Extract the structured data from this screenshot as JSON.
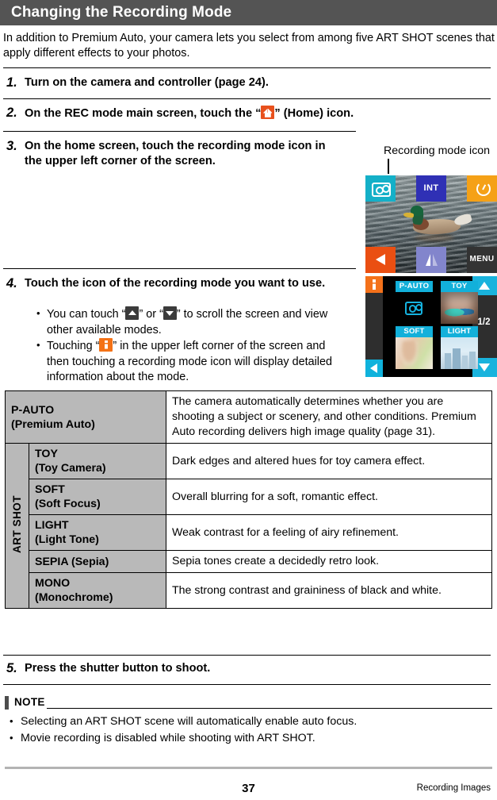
{
  "header": {
    "title": "Changing the Recording Mode"
  },
  "intro": "In addition to Premium Auto, your camera lets you select from among five ART SHOT scenes that apply different effects to your photos.",
  "steps": [
    {
      "num": "1.",
      "text_before": "Turn on the camera and controller (page 24).",
      "text_after": ""
    },
    {
      "num": "2.",
      "text_before": "On the REC mode main screen, touch the “",
      "text_after": "” (Home) icon."
    },
    {
      "num": "3.",
      "text_before": "On the home screen, touch the recording mode icon in the upper left corner of the screen.",
      "text_after": ""
    },
    {
      "num": "4.",
      "text_before": "Touch the icon of the recording mode you want to use.",
      "text_after": ""
    },
    {
      "num": "5.",
      "text_before": "Press the shutter button to shoot.",
      "text_after": ""
    }
  ],
  "step4_bullets": [
    {
      "part1": "You can touch “",
      "part2": "” or “",
      "part3": "” to scroll the screen and view other available modes."
    },
    {
      "part1": "Touching “",
      "part2": "” in the upper left corner of the screen and then touching a recording mode icon will display detailed information about the mode."
    }
  ],
  "callout": {
    "label": "Recording mode icon"
  },
  "screen_home": {
    "tiles": [
      {
        "name": "camera-mode",
        "label": "",
        "icon": "camera-icon",
        "color": "#14b0c8"
      },
      {
        "name": "interval",
        "label": "INT",
        "icon": "",
        "color": "#2f30b5"
      },
      {
        "name": "self-timer",
        "label": "",
        "icon": "timer-icon",
        "color": "#f5a117"
      },
      {
        "name": "back",
        "label": "",
        "icon": "triangle-left-icon",
        "color": "#ea4f12"
      },
      {
        "name": "flip",
        "label": "",
        "icon": "flip-icon",
        "color": "#8285cc"
      },
      {
        "name": "menu",
        "label": "MENU",
        "icon": "",
        "color": "#333333"
      }
    ]
  },
  "screen_modes": {
    "page_indicator": "1/2",
    "cells": [
      {
        "label": "P-AUTO",
        "thumb": "camera-icon"
      },
      {
        "label": "TOY",
        "thumb": "toy-photo"
      },
      {
        "label": "SOFT",
        "thumb": "soft-photo"
      },
      {
        "label": "LIGHT",
        "thumb": "light-photo"
      }
    ]
  },
  "table": {
    "group_label": "ART SHOT",
    "rows": [
      {
        "name": "P-AUTO\n(Premium Auto)",
        "name_l1": "P-AUTO",
        "name_l2": "(Premium Auto)",
        "desc": "The camera automatically determines whether you are shooting a subject or scenery, and other conditions. Premium Auto recording delivers high image quality (page 31)."
      },
      {
        "name_l1": "TOY",
        "name_l2": "(Toy Camera)",
        "desc": "Dark edges and altered hues for toy camera effect."
      },
      {
        "name_l1": "SOFT",
        "name_l2": "(Soft Focus)",
        "desc": "Overall blurring for a soft, romantic effect."
      },
      {
        "name_l1": "LIGHT",
        "name_l2": "(Light Tone)",
        "desc": "Weak contrast for a feeling of airy refinement."
      },
      {
        "name_l1": "SEPIA (Sepia)",
        "name_l2": "",
        "desc": "Sepia tones create a decidedly retro look."
      },
      {
        "name_l1": "MONO",
        "name_l2": "(Monochrome)",
        "desc": "The strong contrast and graininess of black and white."
      }
    ]
  },
  "note": {
    "title": "NOTE",
    "items": [
      "Selecting an ART SHOT scene will automatically enable auto focus.",
      "Movie recording is disabled while shooting with ART SHOT."
    ]
  },
  "footer": {
    "page_number": "37",
    "section": "Recording Images"
  }
}
